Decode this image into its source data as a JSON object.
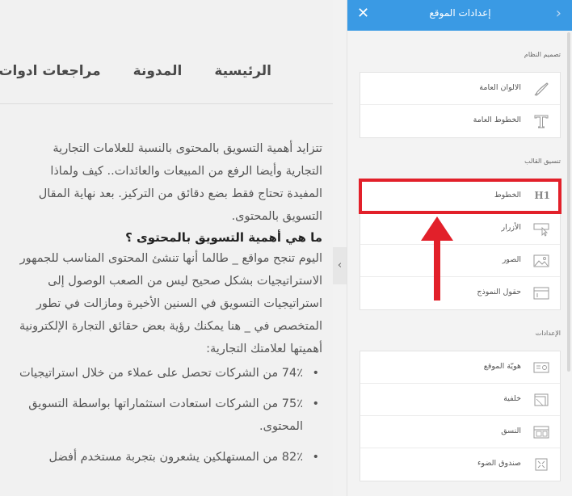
{
  "preview": {
    "nav": [
      "الرئيسية",
      "المدونة",
      "مراجعات ادوات"
    ],
    "article": {
      "p1": [
        "تتزايد أهمية التسويق بالمحتوى بالنسبة للعلامات التجارية",
        "التجارية وأيضا الرفع من المبيعات والعائدات.. كيف ولماذا",
        "المفيدة تحتاج فقط بضع دقائق من التركيز. بعد نهاية المقال",
        "التسويق بالمحتوى."
      ],
      "heading": "ما هي أهمية التسويق بالمحتوى ؟",
      "p2": [
        "اليوم تنجح مواقع _ طالما أنها تنشئ المحتوى المناسب للجمهور",
        "الاستراتيجيات بشكل صحيح ليس من الصعب الوصول إلى",
        "استراتيجيات التسويق في السنين الأخيرة ومازالت في تطور",
        "المتخصص في _ هنا يمكنك رؤية بعض حقائق التجارة الإلكترونية",
        "أهميتها لعلامتك التجارية:"
      ],
      "bullets": [
        [
          "74٪ من الشركات تحصل على عملاء من خلال استراتيجيات"
        ],
        [
          "75٪ من الشركات استعادت استثماراتها بواسطة التسويق",
          "المحتوى."
        ],
        [
          "82٪ من المستهلكين يشعرون بتجربة مستخدم أفضل"
        ]
      ]
    },
    "toggle_icon": "chevron-right"
  },
  "sidebar": {
    "title": "إعدادات الموقع",
    "close_icon": "close-x",
    "back_icon": "chevron-right",
    "sections": [
      {
        "label": "تصميم النظام",
        "items": [
          {
            "label": "الالوان العامة",
            "icon": "brush-icon"
          },
          {
            "label": "الخطوط العامة",
            "icon": "text-t-icon"
          }
        ]
      },
      {
        "label": "تنسيق القالب",
        "items": [
          {
            "label": "الخطوط",
            "icon": "h1-icon",
            "icon_text": "H1",
            "selected": true
          },
          {
            "label": "الأزرار",
            "icon": "cursor-button-icon"
          },
          {
            "label": "الصور",
            "icon": "image-icon"
          },
          {
            "label": "حقول النموذج",
            "icon": "form-field-icon"
          }
        ]
      },
      {
        "label": "الإعدادات",
        "items": [
          {
            "label": "هويّة الموقع",
            "icon": "id-card-icon"
          },
          {
            "label": "خلفية",
            "icon": "background-icon"
          },
          {
            "label": "النسق",
            "icon": "layout-icon"
          },
          {
            "label": "صندوق الضوء",
            "icon": "lightbox-icon"
          }
        ]
      }
    ]
  },
  "colors": {
    "header_bg": "#3a9ae4",
    "highlight": "#e2202a",
    "annotation_arrow": "#e2202a"
  }
}
